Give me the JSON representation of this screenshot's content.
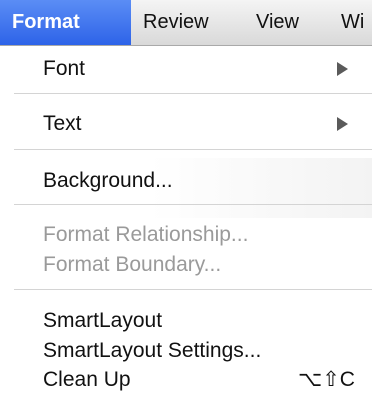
{
  "menubar": {
    "items": [
      {
        "label": "Format"
      },
      {
        "label": "Review"
      },
      {
        "label": "View"
      },
      {
        "label": "Wi"
      }
    ]
  },
  "menu": {
    "font_label": "Font",
    "text_label": "Text",
    "background_label": "Background...",
    "format_relationship_label": "Format Relationship...",
    "format_boundary_label": "Format Boundary...",
    "smartlayout_label": "SmartLayout",
    "smartlayout_settings_label": "SmartLayout Settings...",
    "clean_up_label": "Clean Up",
    "clean_up_shortcut": "⌥⇧C"
  },
  "colors": {
    "active_menu": "#3b72ee",
    "disabled_text": "#9a9a9a"
  }
}
